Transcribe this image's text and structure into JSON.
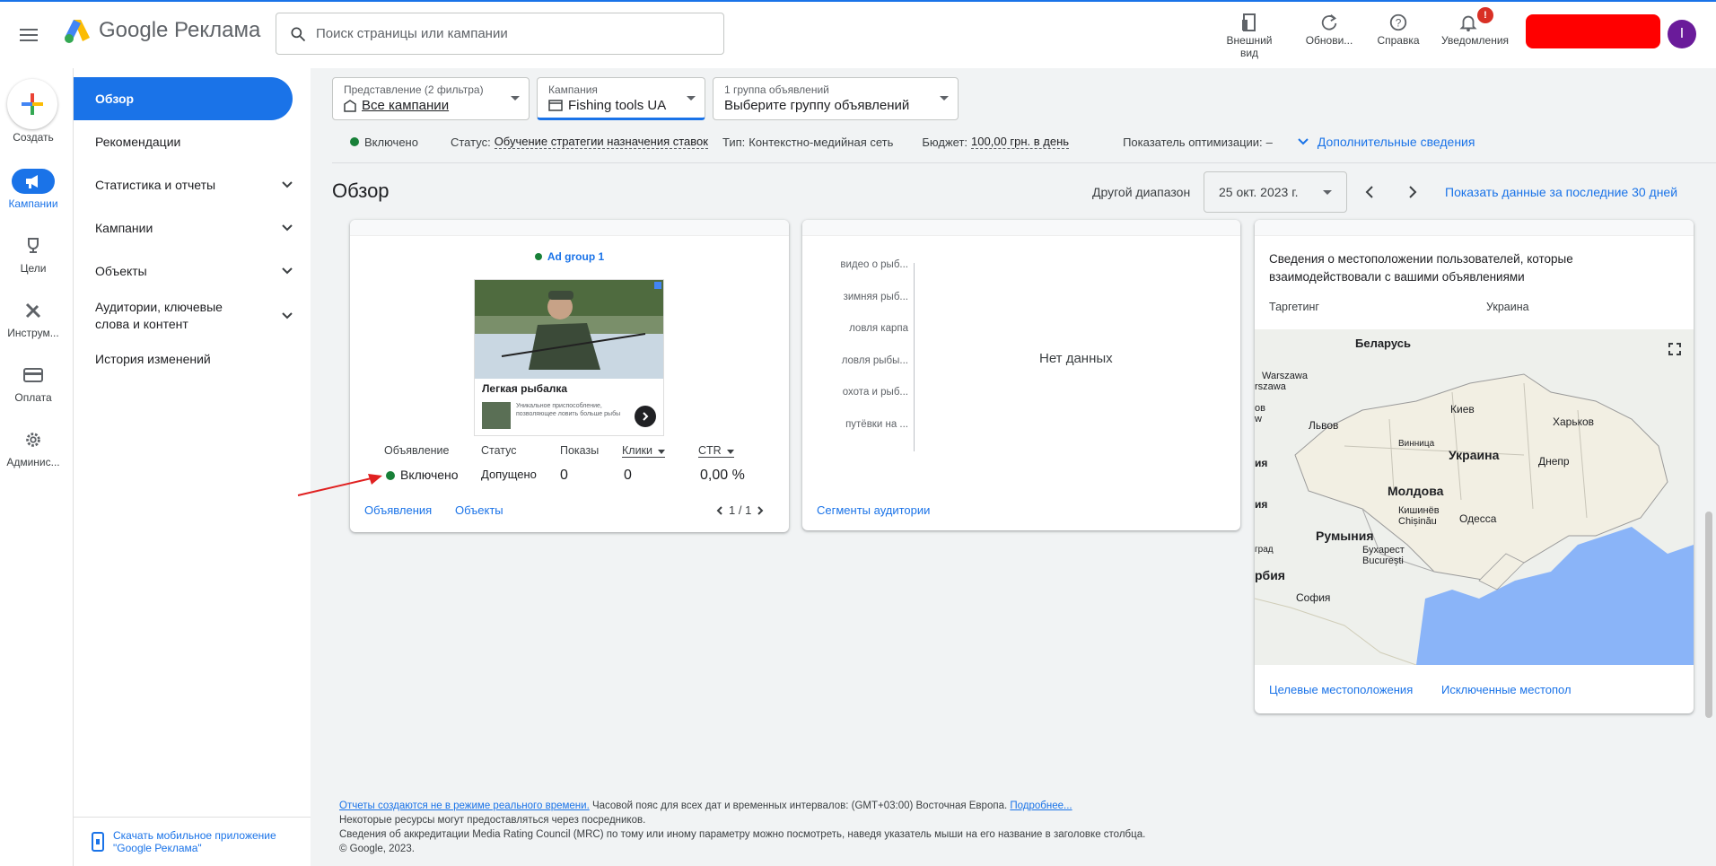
{
  "app": {
    "logo_text": "Google Реклама"
  },
  "search": {
    "placeholder": "Поиск страницы или кампании"
  },
  "toolbar": {
    "appearance": "Внешний вид",
    "refresh": "Обнови...",
    "help": "Справка",
    "notifications": "Уведомления",
    "notif_count": "!",
    "avatar_letter": "I"
  },
  "rail": {
    "create": "Создать",
    "campaigns": "Кампании",
    "goals": "Цели",
    "tools": "Инструм...",
    "billing": "Оплата",
    "admin": "Админис..."
  },
  "nav": {
    "items": [
      "Обзор",
      "Рекомендации",
      "Статистика и отчеты",
      "Кампании",
      "Объекты",
      "Аудитории, ключевые слова и контент",
      "История изменений"
    ],
    "download_app": "Скачать мобильное приложение \"Google Реклама\""
  },
  "filters": {
    "view_label": "Представление (2 фильтра)",
    "view_value": "Все кампании",
    "campaign_label": "Кампания",
    "campaign_value": "Fishing tools UA",
    "adgroup_label": "1 группа объявлений",
    "adgroup_value": "Выберите группу объявлений"
  },
  "status_row": {
    "enabled": "Включено",
    "status_label": "Статус:",
    "status_value": "Обучение стратегии назначения ставок",
    "type_label": "Тип:",
    "type_value": "Контекстно-медийная сеть",
    "budget_label": "Бюджет:",
    "budget_value": "100,00 грн. в день",
    "opt_label": "Показатель оптимизации:",
    "opt_value": "–",
    "more_info": "Дополнительные сведения"
  },
  "page": {
    "title": "Обзор",
    "range_label": "Другой диапазон",
    "date": "25 окт. 2023 г.",
    "last30": "Показать данные за последние 30 дней"
  },
  "card_ads": {
    "adgroup": "Ad group 1",
    "ad_headline": "Легкая рыбалка",
    "ad_desc": "Уникальное приспособление, позволяющее ловить больше рыбы",
    "columns": [
      "Объявление",
      "Статус",
      "Показы",
      "Клики",
      "CTR"
    ],
    "row": {
      "ad": "Включено",
      "status": "Допущено",
      "impressions": "0",
      "clicks": "0",
      "ctr": "0,00 %"
    },
    "link_ads": "Объявления",
    "link_assets": "Объекты",
    "pager": "1 / 1"
  },
  "card_audience": {
    "labels": [
      "видео о рыб...",
      "зимняя рыб...",
      "ловля карпа",
      "ловля рыбы...",
      "охота и рыб...",
      "путёвки на ..."
    ],
    "no_data": "Нет данных",
    "link": "Сегменты аудитории"
  },
  "card_location": {
    "title": "Сведения о местоположении пользователей, которые взаимодействовали с вашими объявлениями",
    "targeting_label": "Таргетинг",
    "targeting_value": "Украина",
    "map_labels": {
      "belarus": "Беларусь",
      "warszawa": "Warszawa",
      "rszawa": "rszawa",
      "lviv": "Львов",
      "kyiv": "Киев",
      "kharkiv": "Харьков",
      "vinnytsia": "Винница",
      "ukraine": "Украина",
      "dnipro": "Днепр",
      "moldova": "Молдова",
      "chisinau1": "Кишинёв",
      "chisinau2": "Chișinău",
      "odesa": "Одесса",
      "romania": "Румыния",
      "bucharest1": "Бухарест",
      "bucharest2": "București",
      "serbia": "рбия",
      "sofia": "София",
      "ob": "ов",
      "w": "w",
      "ia1": "ия",
      "ia2": "ия",
      "grad": "град"
    },
    "link_target": "Целевые местоположения",
    "link_excluded": "Исключенные местопол"
  },
  "footer": {
    "line1_link": "Отчеты создаются не в режиме реального времени.",
    "line1_text": " Часовой пояс для всех дат и временных интервалов: (GMT+03:00) Восточная Европа. ",
    "line1_more": "Подробнее...",
    "line2": "Некоторые ресурсы могут предоставляться через посредников.",
    "line3": "Сведения об аккредитации Media Rating Council (MRC) по тому или иному параметру можно посмотреть, наведя указатель мыши на его название в заголовке столбца.",
    "line4": "© Google, 2023."
  },
  "colors": {
    "accent": "#1a73e8",
    "enabled": "#188038",
    "brand_red": "#ff0000"
  }
}
